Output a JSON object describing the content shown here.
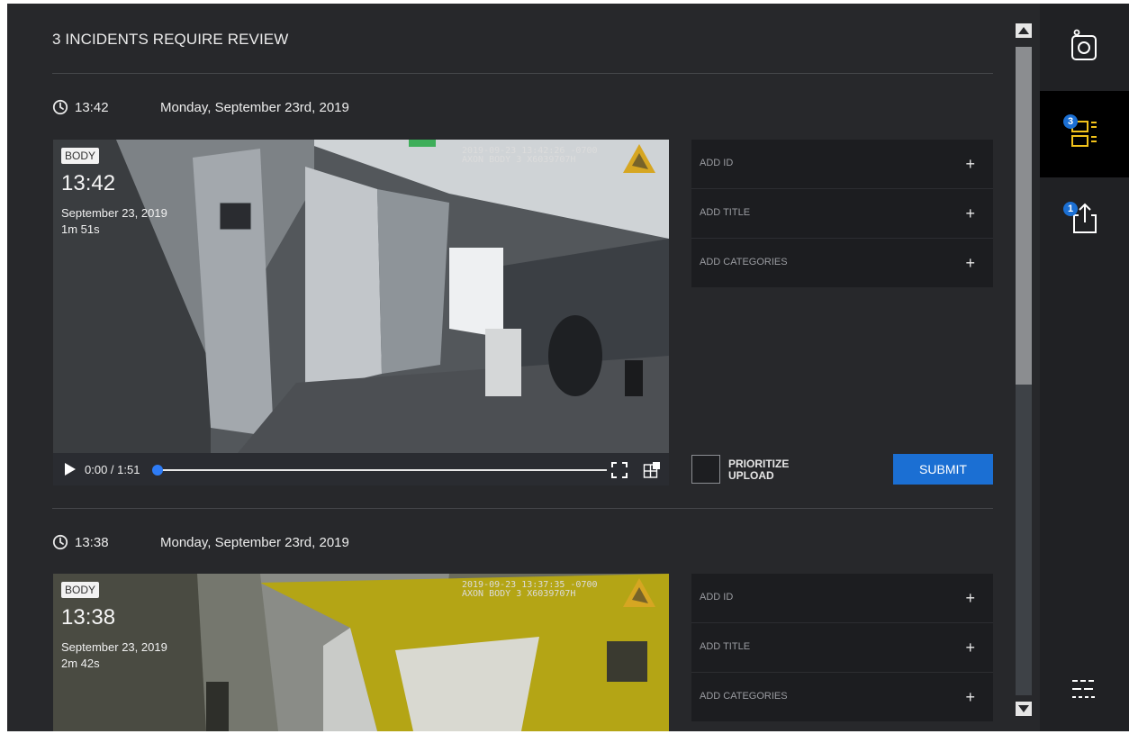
{
  "page": {
    "title": "3 INCIDENTS REQUIRE REVIEW"
  },
  "incidents": [
    {
      "time": "13:42",
      "date": "Monday, September 23rd, 2019",
      "video": {
        "badge": "BODY",
        "time": "13:42",
        "date": "September 23, 2019",
        "duration": "1m 51s",
        "stamp_line1": "2019-09-23 13:42:26 -0700",
        "stamp_line2": "AXON BODY 3 X6039707H",
        "timecode": "0:00 / 1:51",
        "progress": 0
      },
      "fields": [
        {
          "label": "ADD ID"
        },
        {
          "label": "ADD TITLE"
        },
        {
          "label": "ADD CATEGORIES"
        }
      ],
      "prioritize_line1": "PRIORITIZE",
      "prioritize_line2": "UPLOAD",
      "submit_label": "SUBMIT"
    },
    {
      "time": "13:38",
      "date": "Monday, September 23rd, 2019",
      "video": {
        "badge": "BODY",
        "time": "13:38",
        "date": "September 23, 2019",
        "duration": "2m 42s",
        "stamp_line1": "2019-09-23 13:37:35 -0700",
        "stamp_line2": "AXON BODY 3 X6039707H"
      },
      "fields": [
        {
          "label": "ADD ID"
        },
        {
          "label": "ADD TITLE"
        },
        {
          "label": "ADD CATEGORIES"
        }
      ]
    }
  ],
  "rail": {
    "items": [
      {
        "icon": "camera-icon"
      },
      {
        "icon": "review-list-icon",
        "badge": "3",
        "active": true
      },
      {
        "icon": "upload-icon",
        "badge": "1"
      },
      {
        "icon": "settings-sliders-icon"
      }
    ]
  },
  "colors": {
    "accent": "#1b6fd3",
    "background": "#27282b",
    "rail": "#202124"
  }
}
